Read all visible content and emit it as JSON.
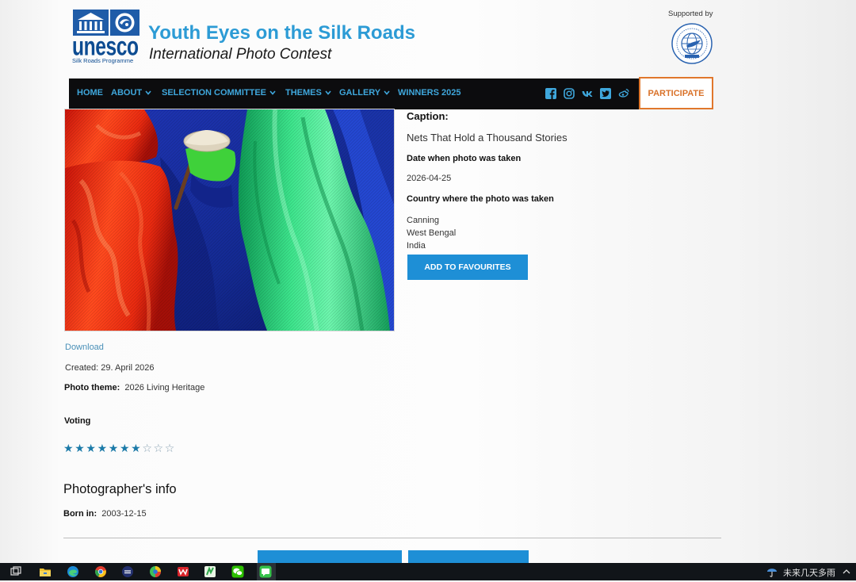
{
  "header": {
    "brand": "unesco",
    "programme": "Silk Roads Programme",
    "title": "Youth Eyes on the Silk Roads",
    "subtitle": "International Photo Contest",
    "supported_by": "Supported by",
    "icons": [
      "unesco-temple-icon",
      "silk-roads-emblem-icon",
      "partner-globe-dove-icon"
    ]
  },
  "nav": {
    "items": [
      {
        "label": "HOME",
        "dropdown": false
      },
      {
        "label": "ABOUT",
        "dropdown": true
      },
      {
        "label": "SELECTION COMMITTEE",
        "dropdown": true
      },
      {
        "label": "THEMES",
        "dropdown": true
      },
      {
        "label": "GALLERY",
        "dropdown": true
      },
      {
        "label": "WINNERS 2025",
        "dropdown": false
      }
    ],
    "social_icons": [
      "facebook-icon",
      "instagram-icon",
      "vk-icon",
      "twitter-icon",
      "weibo-icon"
    ],
    "participate_label": "PARTICIPATE"
  },
  "details": {
    "caption_label": "Caption:",
    "caption": "Nets That Hold a Thousand Stories",
    "date_label": "Date when photo was taken",
    "date": "2026-04-25",
    "country_label": "Country where the photo was taken",
    "location": [
      "Canning",
      "West Bengal",
      "India"
    ],
    "favourites_label": "ADD TO FAVOURITES"
  },
  "meta": {
    "download_label": "Download",
    "created_label": "Created:",
    "created_date": "29. April 2026",
    "theme_label": "Photo theme:",
    "theme": "2026 Living Heritage",
    "voting_label": "Voting",
    "rating": 7,
    "rating_max": 10
  },
  "photographer": {
    "heading": "Photographer's info",
    "born_label": "Born in:",
    "born": "2003-12-15"
  },
  "taskbar": {
    "icons": [
      "task-view-icon",
      "file-explorer-icon",
      "edge-icon",
      "chrome-icon",
      "app-icon",
      "browser-icon",
      "wps-icon",
      "green-app-icon",
      "wechat-icon",
      "chat-app-icon"
    ],
    "weather_icon": "rain-umbrella-icon",
    "weather": "未来几天多雨"
  },
  "colors": {
    "accent_blue": "#2c9bd5",
    "nav_link": "#3fa7dc",
    "button_blue": "#1e8fd6",
    "participate_orange": "#e0772c",
    "star_filled": "#1b7aa8"
  }
}
